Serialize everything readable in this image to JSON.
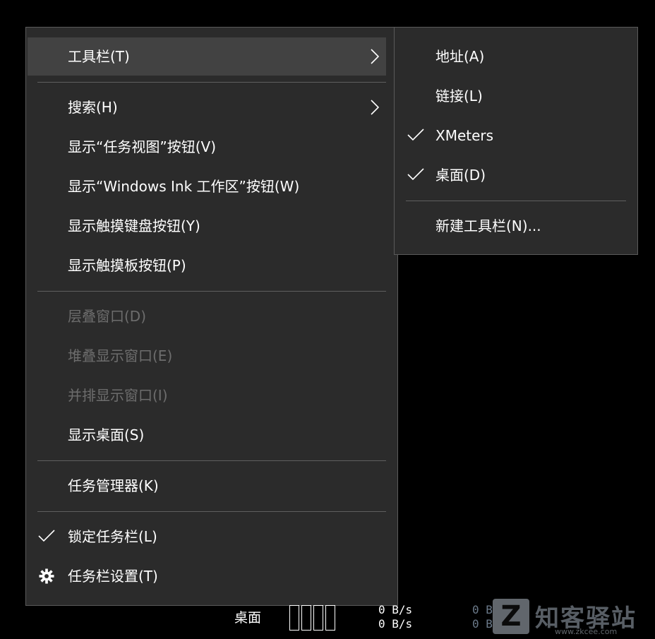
{
  "main_menu": {
    "items": [
      {
        "label": "工具栏(T)",
        "state": "highlight",
        "has_submenu": true
      },
      {
        "label": "搜索(H)",
        "has_submenu": true
      },
      {
        "label": "显示“任务视图”按钮(V)"
      },
      {
        "label": "显示“Windows Ink 工作区”按钮(W)"
      },
      {
        "label": "显示触摸键盘按钮(Y)"
      },
      {
        "label": "显示触摸板按钮(P)"
      },
      {
        "label": "层叠窗口(D)",
        "state": "disabled"
      },
      {
        "label": "堆叠显示窗口(E)",
        "state": "disabled"
      },
      {
        "label": "并排显示窗口(I)",
        "state": "disabled"
      },
      {
        "label": "显示桌面(S)"
      },
      {
        "label": "任务管理器(K)"
      },
      {
        "label": "锁定任务栏(L)",
        "checked": true
      },
      {
        "label": "任务栏设置(T)",
        "icon": "gear-icon"
      }
    ]
  },
  "submenu": {
    "items": [
      {
        "label": "地址(A)"
      },
      {
        "label": "链接(L)"
      },
      {
        "label": "XMeters",
        "checked": true
      },
      {
        "label": "桌面(D)",
        "checked": true
      },
      {
        "label": "新建工具栏(N)..."
      }
    ]
  },
  "taskbar": {
    "desktop_label": "桌面",
    "netspeed_a": [
      "0 B/s",
      "0 B/s"
    ],
    "netspeed_b": [
      "0 B",
      "0 B"
    ],
    "watermark_text": "知客驿站",
    "watermark_url": "www.zkcee.com",
    "watermark_logo": "Z"
  },
  "colors": {
    "menu_bg": "#2b2b2b",
    "highlight_bg": "#424242",
    "text": "#ffffff",
    "disabled_text": "#6d6d6d",
    "separator": "#5f5f5f"
  }
}
